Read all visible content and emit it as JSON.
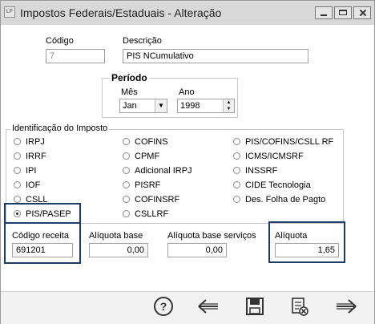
{
  "window": {
    "title": "Impostos Federais/Estaduais - Alteração"
  },
  "form": {
    "codigo_label": "Código",
    "codigo_value": "7",
    "descricao_label": "Descrição",
    "descricao_value": "PIS NCumulativo"
  },
  "periodo": {
    "title": "Período",
    "mes_label": "Mês",
    "mes_value": "Jan",
    "ano_label": "Ano",
    "ano_value": "1998"
  },
  "identificacao": {
    "title": "Identificação do Imposto",
    "options_col1": [
      "IRPJ",
      "IRRF",
      "IPI",
      "IOF",
      "CSLL",
      "PIS/PASEP"
    ],
    "options_col2": [
      "COFINS",
      "CPMF",
      "Adicional IRPJ",
      "PISRF",
      "COFINSRF",
      "CSLLRF"
    ],
    "options_col3": [
      "PIS/COFINS/CSLL RF",
      "ICMS/ICMSRF",
      "INSSRF",
      "CIDE Tecnologia",
      "Des. Folha de Pagto"
    ],
    "selected": "PIS/PASEP"
  },
  "valores": {
    "codigo_receita_label": "Código receita",
    "codigo_receita_value": "691201",
    "aliquota_base_label": "Alíquota base",
    "aliquota_base_value": "0,00",
    "aliquota_base_servicos_label": "Alíquota base serviços",
    "aliquota_base_servicos_value": "0,00",
    "aliquota_label": "Alíquota",
    "aliquota_value": "1,65"
  },
  "toolbar": {
    "icons": [
      "help-icon",
      "back-icon",
      "save-icon",
      "delete-icon",
      "forward-icon"
    ]
  },
  "colors": {
    "highlight": "#1a3c6b",
    "titlebar": "#d9d9d9"
  }
}
